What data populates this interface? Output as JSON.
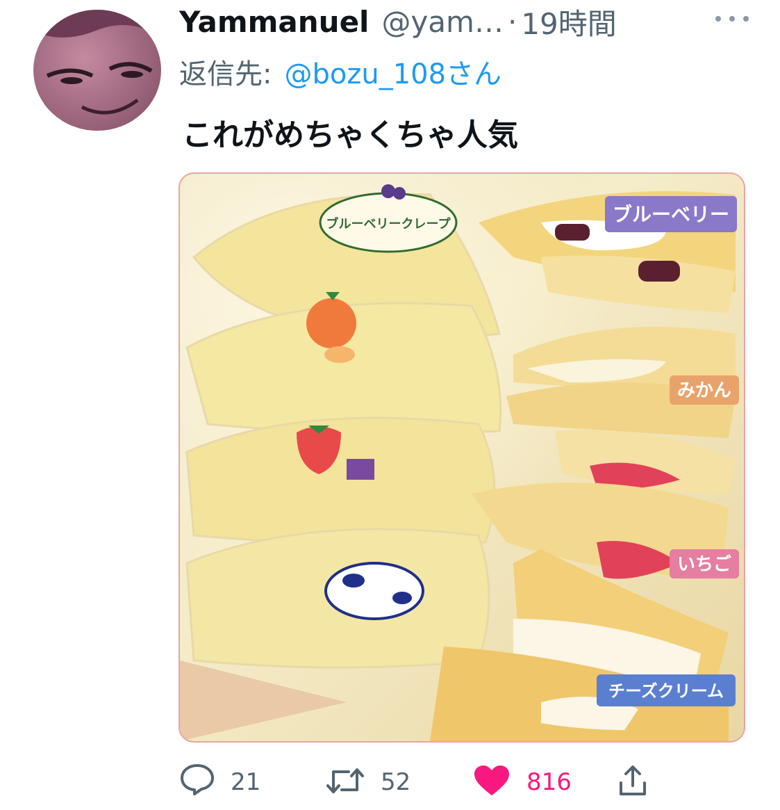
{
  "tweet": {
    "author_name": "Yammanuel",
    "handle": "@yam…",
    "separator": "·",
    "time": "19時間",
    "reply_label": "返信先:",
    "reply_mention": "@bozu_108さん",
    "text": "これがめちゃくちゃ人気"
  },
  "media": {
    "labels": [
      {
        "text": "ブルーベリー",
        "color": "#8a78c8"
      },
      {
        "text": "みかん",
        "color": "#e8a36b"
      },
      {
        "text": "いちご",
        "color": "#e57ea0"
      },
      {
        "text": "チーズクリーム",
        "color": "#5b7fd0"
      }
    ],
    "package_logo": "ブルーベリークレープ"
  },
  "actions": {
    "reply_count": "21",
    "retweet_count": "52",
    "like_count": "816"
  },
  "colors": {
    "accent": "#1d9bf0",
    "like": "#f91880",
    "muted": "#536471"
  }
}
